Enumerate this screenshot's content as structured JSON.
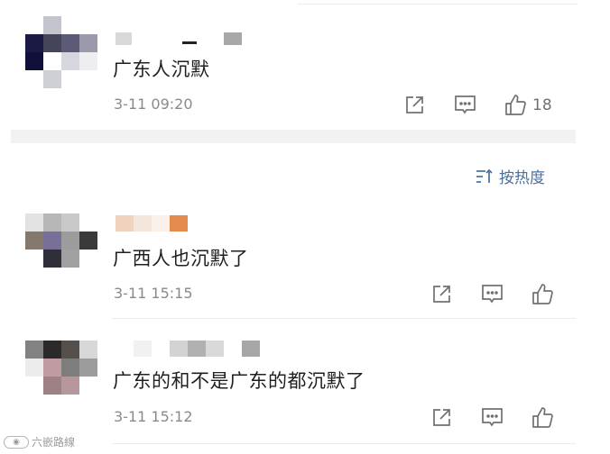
{
  "comments": [
    {
      "text": "广东人沉默",
      "time": "3-11 09:20",
      "like_count": "18"
    },
    {
      "text": "广西人也沉默了",
      "time": "3-11 15:15",
      "like_count": ""
    },
    {
      "text": "广东的和不是广东的都沉默了",
      "time": "3-11 15:12",
      "like_count": ""
    }
  ],
  "sort": {
    "label": "按热度"
  },
  "watermark": {
    "text": "六嵌路線"
  },
  "icons": {
    "share": "share-icon",
    "comment": "comment-icon",
    "like": "thumbs-up-icon",
    "sort": "sort-icon"
  },
  "colors": {
    "accent": "#4a6f9e",
    "icon_gray": "#707070",
    "time_gray": "#8a8a8a"
  }
}
